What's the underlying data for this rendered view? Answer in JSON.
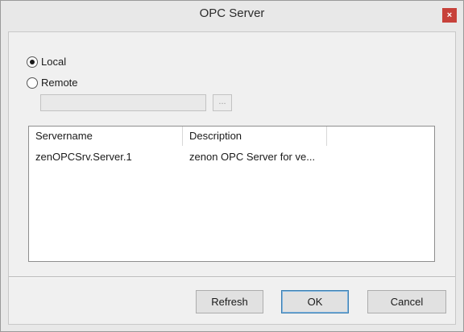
{
  "window": {
    "title": "OPC Server",
    "close_label": "×"
  },
  "source": {
    "local_label": "Local",
    "remote_label": "Remote",
    "selected": "Local",
    "remote_value": "",
    "browse_label": "..."
  },
  "server_list": {
    "columns": [
      "Servername",
      "Description",
      ""
    ],
    "rows": [
      {
        "servername": "zenOPCSrv.Server.1",
        "description": "zenon OPC Server for ve..."
      }
    ]
  },
  "buttons": {
    "refresh_label": "Refresh",
    "ok_label": "OK",
    "cancel_label": "Cancel"
  },
  "colors": {
    "close_button": "#c7413a",
    "default_button_border": "#3c7fb1"
  }
}
